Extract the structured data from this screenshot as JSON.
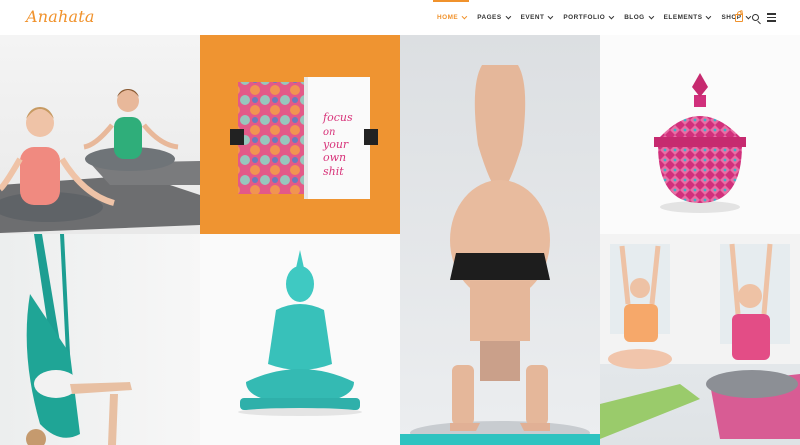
{
  "brand": {
    "logo_text": "Anahata",
    "accent": "#f0922c"
  },
  "nav": {
    "items": [
      {
        "label": "HOME",
        "active": true
      },
      {
        "label": "PAGES"
      },
      {
        "label": "EVENT"
      },
      {
        "label": "PORTFOLIO"
      },
      {
        "label": "BLOG"
      },
      {
        "label": "ELEMENTS"
      },
      {
        "label": "SHOP"
      }
    ]
  },
  "utilities": {
    "cart_count": "0",
    "cart_icon": "cart-icon",
    "search_icon": "search-icon",
    "menu_icon": "hamburger-menu-icon"
  },
  "notebook": {
    "text": "focus on your own shit"
  },
  "colors": {
    "orange": "#ef9431",
    "teal": "#2ec3c0",
    "pink": "#d8347a"
  }
}
